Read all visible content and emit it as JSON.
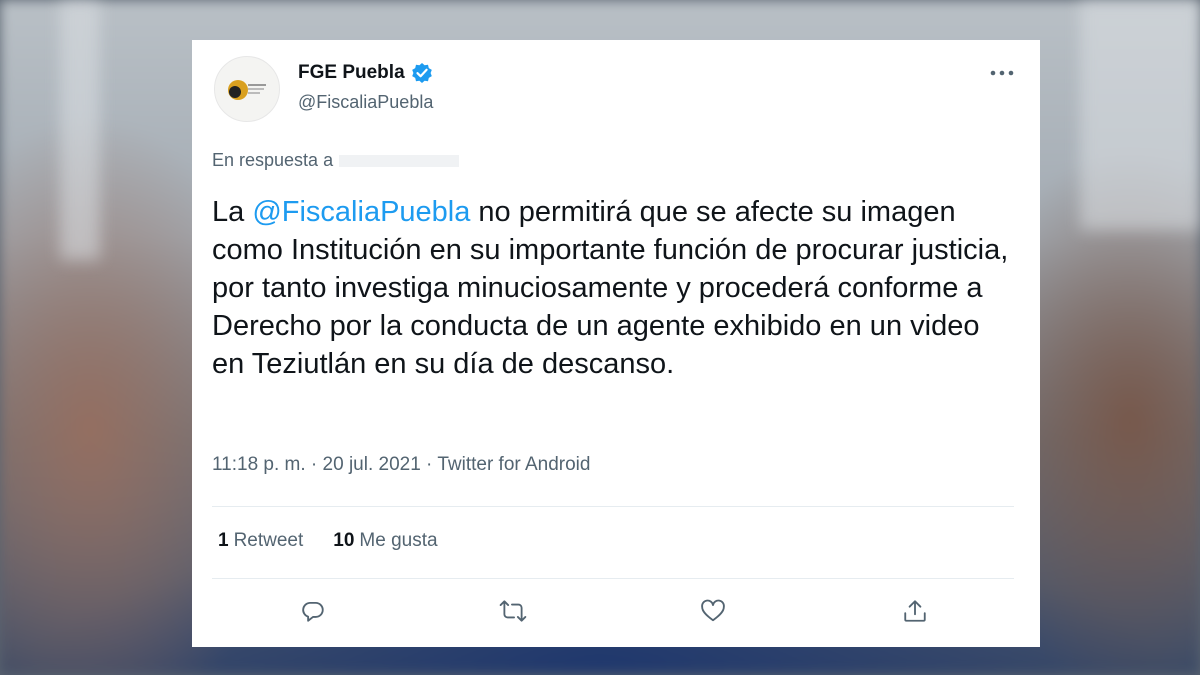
{
  "tweet": {
    "author_name": "FGE Puebla",
    "author_handle": "@FiscaliaPuebla",
    "reply_prefix": "En respuesta a",
    "text_before_mention": "La ",
    "mention": "@FiscaliaPuebla",
    "text_after_mention": " no permitirá que se afecte su imagen como Institución en su importante función de procurar justicia, por tanto investiga minuciosamente y procederá conforme a Derecho por la conducta de un agente exhibido en un video en Teziutlán en su día de descanso.",
    "metadata": "11:18 p. m. · 20 jul. 2021 · Twitter for Android"
  },
  "stats": {
    "retweets_count": "1",
    "retweets_label": "Retweet",
    "likes_count": "10",
    "likes_label": "Me gusta"
  },
  "colors": {
    "accent": "#1d9bf0",
    "text_primary": "#0f1419",
    "text_secondary": "#536471"
  },
  "icons": {
    "verified": "verified-badge-icon",
    "more": "more-horizontal-icon",
    "reply": "reply-icon",
    "retweet": "retweet-icon",
    "like": "heart-icon",
    "share": "share-icon"
  }
}
